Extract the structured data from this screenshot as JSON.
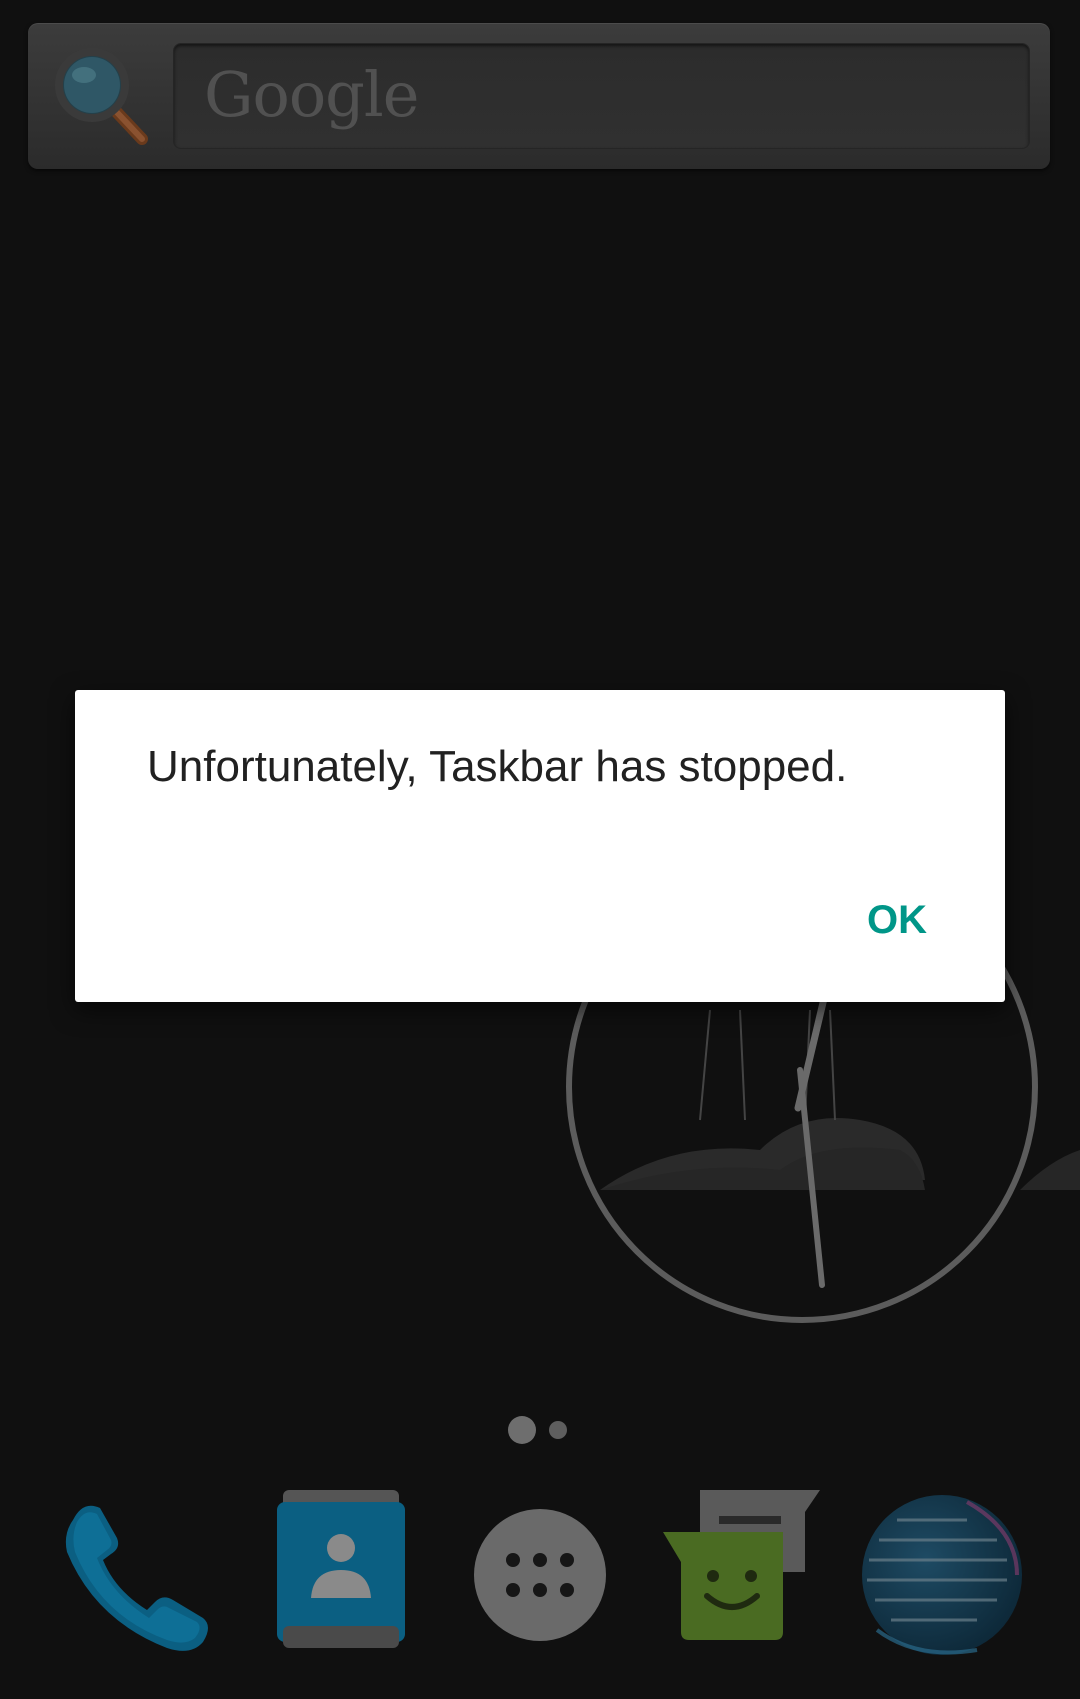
{
  "search_widget": {
    "placeholder": "Google",
    "icon": "search-icon"
  },
  "dialog": {
    "message": "Unfortunately, Taskbar has stopped.",
    "ok_label": "OK",
    "accent_color": "#009688"
  },
  "page_indicator": {
    "pages": 2,
    "current_page": 1
  },
  "dock": {
    "items": [
      {
        "icon": "phone-icon"
      },
      {
        "icon": "contacts-icon"
      },
      {
        "icon": "app-drawer-icon"
      },
      {
        "icon": "messaging-icon"
      },
      {
        "icon": "browser-globe-icon"
      }
    ]
  },
  "colors": {
    "background": "#101010",
    "dialog_background": "#ffffff",
    "dialog_text": "#212121"
  }
}
